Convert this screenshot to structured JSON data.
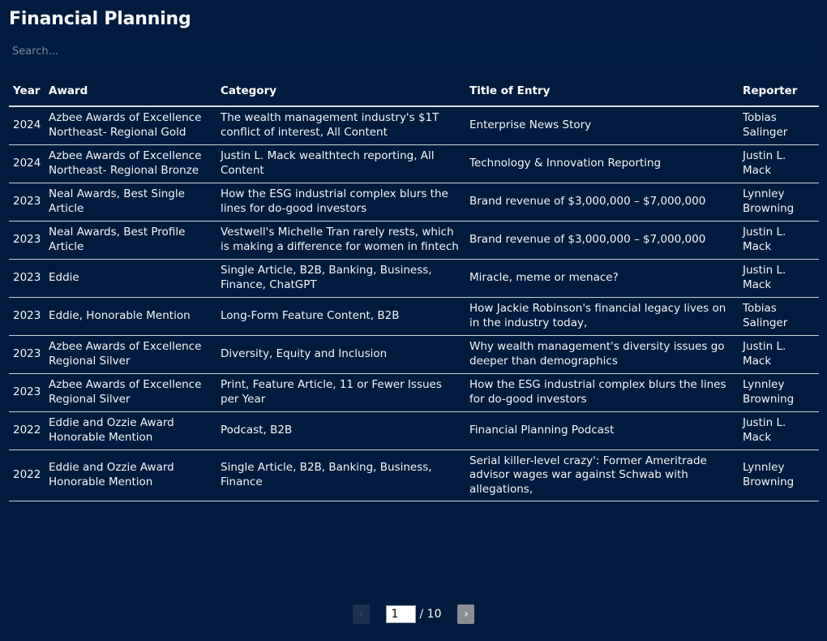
{
  "header": {
    "title": "Financial Planning"
  },
  "search": {
    "placeholder": "Search...",
    "value": ""
  },
  "table": {
    "columns": [
      "Year",
      "Award",
      "Category",
      "Title of Entry",
      "Reporter"
    ],
    "rows": [
      {
        "year": "2024",
        "award": "Azbee Awards of Excellence Northeast- Regional Gold",
        "category": "The wealth management industry's $1T conflict of interest, All Content",
        "title": "Enterprise News Story",
        "reporter": "Tobias Salinger"
      },
      {
        "year": "2024",
        "award": "Azbee Awards of Excellence Northeast- Regional Bronze",
        "category": "Justin L. Mack wealthtech reporting, All Content",
        "title": "Technology & Innovation Reporting",
        "reporter": "Justin L. Mack"
      },
      {
        "year": "2023",
        "award": "Neal Awards, Best Single Article",
        "category": "How the ESG industrial complex blurs the lines for do-good investors",
        "title": "Brand revenue of $3,000,000 – $7,000,000",
        "reporter": "Lynnley Browning"
      },
      {
        "year": "2023",
        "award": "Neal Awards, Best Profile Article",
        "category": "Vestwell's Michelle Tran rarely rests, which is making a difference for women in fintech",
        "title": "Brand revenue of $3,000,000 – $7,000,000",
        "reporter": "Justin L. Mack"
      },
      {
        "year": "2023",
        "award": "Eddie",
        "category": "Single Article, B2B, Banking, Business, Finance, ChatGPT",
        "title": "Miracle, meme or menace?",
        "reporter": "Justin L. Mack"
      },
      {
        "year": "2023",
        "award": "Eddie, Honorable Mention",
        "category": "Long-Form Feature Content, B2B",
        "title": "How Jackie Robinson's financial legacy lives on in the industry today,",
        "reporter": "Tobias Salinger"
      },
      {
        "year": "2023",
        "award": "Azbee Awards of Excellence Regional Silver",
        "category": "Diversity, Equity and Inclusion",
        "title": "Why wealth management's diversity issues go deeper than demographics",
        "reporter": "Justin L. Mack"
      },
      {
        "year": "2023",
        "award": "Azbee Awards of Excellence Regional Silver",
        "category": "Print, Feature Article, 11 or Fewer Issues per Year",
        "title": "How the ESG industrial complex blurs the lines for do-good investors",
        "reporter": "Lynnley Browning"
      },
      {
        "year": "2022",
        "award": "Eddie and Ozzie Award Honorable Mention",
        "category": "Podcast, B2B",
        "title": "Financial Planning Podcast",
        "reporter": "Justin L. Mack"
      },
      {
        "year": "2022",
        "award": "Eddie and Ozzie Award Honorable Mention",
        "category": "Single Article, B2B, Banking, Business, Finance",
        "title": "Serial killer-level crazy': Former Ameritrade advisor wages war against Schwab with allegations,",
        "reporter": "Lynnley Browning"
      }
    ]
  },
  "pagination": {
    "prev_icon": "‹",
    "next_icon": "›",
    "current_page": "1",
    "total_label": "/ 10",
    "total_pages": 10
  }
}
